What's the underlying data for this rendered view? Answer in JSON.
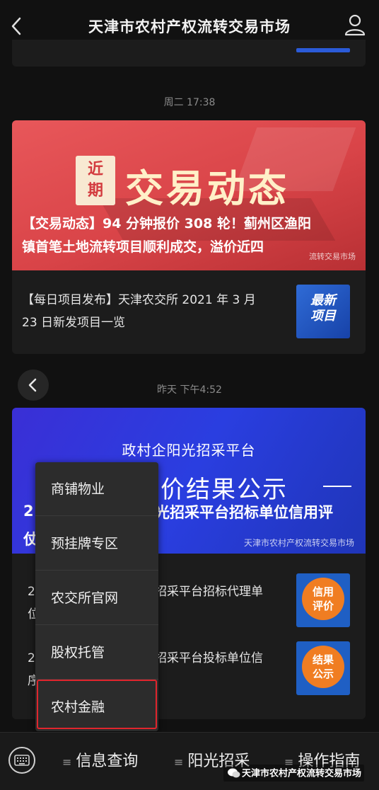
{
  "header": {
    "title": "天津市农村产权流转交易市场"
  },
  "timeline": {
    "time1": "周二 17:38",
    "time2": "昨天 下午4:52"
  },
  "card1": {
    "badge_top": "近",
    "badge_bottom": "期",
    "banner_title": "交易动态",
    "headline_line1": "【交易动态】94 分钟报价 308 轮！蓟州区渔阳",
    "headline_line2": "镇首笔土地流转项目顺利成交，溢价近四",
    "watermark": "流转交易市场",
    "item_line1": "【每日项目发布】天津农交所 2021 年 3 月",
    "item_line2": "23 日新发项目一览",
    "thumb_line1": "最新",
    "thumb_line2": "项目"
  },
  "card2": {
    "banner_sub": "政村企阳光招采平台",
    "banner_title": "价结果公示",
    "headline_fragment": "光招采平台招标单位信用评",
    "left_char1": "2",
    "left_char2": "仗",
    "watermark": "天津市农村产权流转交易市场",
    "item1_prefix1": "2",
    "item1_prefix2": "位",
    "item1_line1": "招采平台招标代理单",
    "item2_prefix1": "2",
    "item2_prefix2": "序",
    "item2_line1": "招采平台投标单位信",
    "thumb1_line1": "信用",
    "thumb1_line2": "评价",
    "thumb2_line1": "结果",
    "thumb2_line2": "公示"
  },
  "menu": {
    "items": [
      "商铺物业",
      "预挂牌专区",
      "农交所官网",
      "股权托管",
      "农村金融"
    ]
  },
  "bottom_tabs": {
    "tab1": "信息查询",
    "tab2": "阳光招采",
    "tab3": "操作指南"
  },
  "watermark_bottom": "天津市农村产权流转交易市场"
}
